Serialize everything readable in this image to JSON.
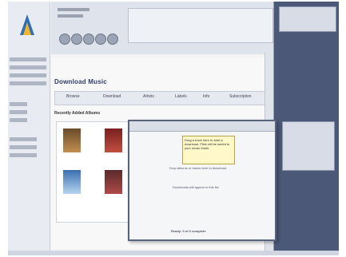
{
  "page": {
    "title": "Download Music"
  },
  "tabs": [
    "Browse",
    "Download",
    "Artists",
    "Labels",
    "Info",
    "Subscription"
  ],
  "section_title": "Recently Added Albums",
  "dialog": {
    "tooltip": "Drag a track here to start a download. Files will be saved to your music folder.",
    "line1": "Drop albums or tracks here to download",
    "line2": "Downloads will appear in this list",
    "footer": "Ready: 0 of 0 complete"
  },
  "colors": {
    "accent": "#2c3e66",
    "desktop": "#5d6a88"
  }
}
